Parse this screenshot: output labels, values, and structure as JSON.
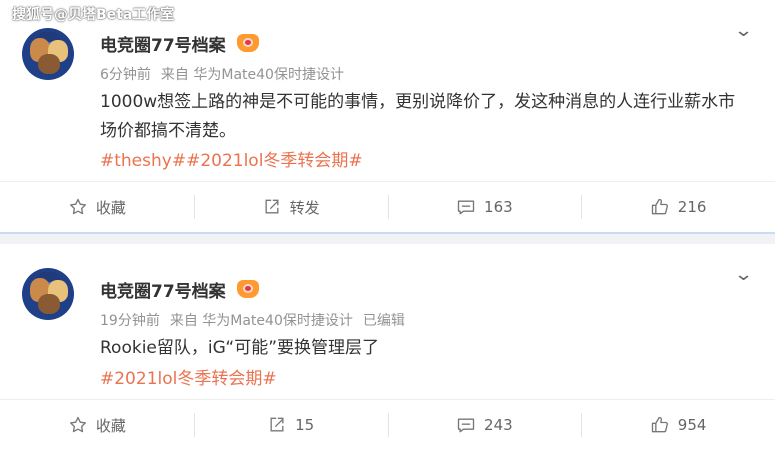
{
  "watermark": "搜狐号@贝塔Beta工作室",
  "posts": [
    {
      "author": "电竞圈77号档案",
      "time": "6分钟前",
      "source": "来自 华为Mate40保时捷设计",
      "edited": "",
      "text": "1000w想签上路的神是不可能的事情，更别说降价了，发这种消息的人连行业薪水市场价都搞不清楚。",
      "tags": "#theshy##2021lol冬季转会期#",
      "actions": {
        "favorite": "收藏",
        "repost": "转发",
        "comments": "163",
        "likes": "216"
      }
    },
    {
      "author": "电竞圈77号档案",
      "time": "19分钟前",
      "source": "来自 华为Mate40保时捷设计",
      "edited": "已编辑",
      "text": "Rookie留队，iG“可能”要换管理层了",
      "tags": "#2021lol冬季转会期#",
      "actions": {
        "favorite": "收藏",
        "repost": "15",
        "comments": "243",
        "likes": "954"
      }
    }
  ],
  "icons": {
    "favorite": "star-icon",
    "repost": "share-icon",
    "comments": "comment-icon",
    "likes": "thumbs-up-icon",
    "menu": "chevron-down-icon",
    "badge": "vip-badge-icon"
  },
  "colors": {
    "tag": "#eb7350",
    "meta": "#939393",
    "divider": "#c8dcf2",
    "badge": "#ff9a2e"
  }
}
